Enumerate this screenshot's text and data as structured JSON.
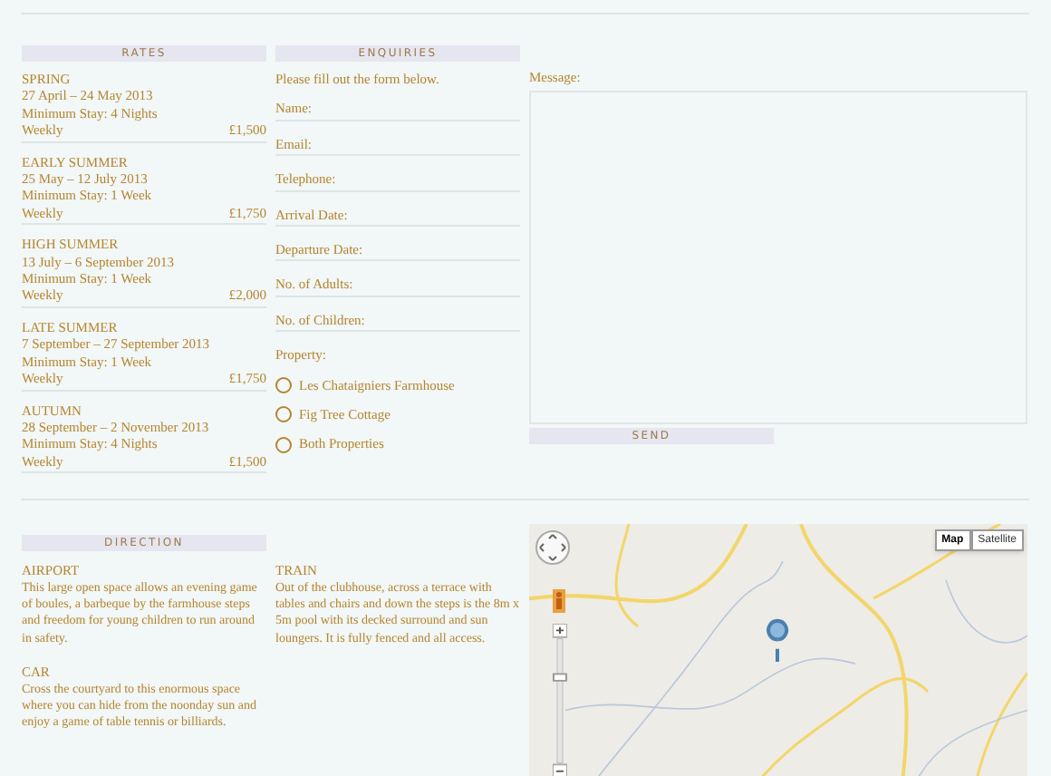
{
  "rates": {
    "title": "RATES",
    "periods": [
      {
        "name": "SPRING",
        "dates": "27 April – 24 May 2013",
        "min_stay": "Minimum Stay: 4 Nights",
        "label": "Weekly",
        "price": "£1,500"
      },
      {
        "name": "EARLY SUMMER",
        "dates": "25 May – 12 July 2013",
        "min_stay": "Minimum Stay: 1 Week",
        "label": "Weekly",
        "price": "£1,750"
      },
      {
        "name": "HIGH SUMMER",
        "dates": "13 July – 6 September 2013",
        "min_stay": "Minimum Stay: 1 Week",
        "label": "Weekly",
        "price": "£2,000"
      },
      {
        "name": "LATE SUMMER",
        "dates": "7 September – 27 September 2013",
        "min_stay": "Minimum Stay: 1 Week",
        "label": "Weekly",
        "price": "£1,750"
      },
      {
        "name": "AUTUMN",
        "dates": "28 September – 2 November 2013",
        "min_stay": "Minimum Stay: 4 Nights",
        "label": "Weekly",
        "price": "£1,500"
      }
    ]
  },
  "enquiries": {
    "title": "ENQUIRIES",
    "intro": "Please fill out the form below.",
    "fields": [
      {
        "label": "Name:"
      },
      {
        "label": "Email:"
      },
      {
        "label": "Telephone:"
      },
      {
        "label": "Arrival Date:"
      },
      {
        "label": "Departure Date:"
      },
      {
        "label": "No. of Adults:"
      },
      {
        "label": "No. of Children:"
      }
    ],
    "property_label": "Property:",
    "options": [
      {
        "label": "Les Chataigniers Farmhouse",
        "selected": false
      },
      {
        "label": "Fig Tree Cottage",
        "selected": false
      },
      {
        "label": "Both Properties",
        "selected": false
      }
    ]
  },
  "message": {
    "label": "Message:",
    "send": "SEND"
  },
  "direction": {
    "title": "DIRECTION",
    "columns": [
      [
        {
          "heading": "AIRPORT",
          "text": "This large open space allows an evening game of boules, a barbeque by the farmhouse steps and freedom for young children to run around in safety."
        },
        {
          "heading": "CAR",
          "text": "Cross the courtyard to this enormous space where you can hide from the noonday sun and enjoy a game of table tennis or billiards."
        }
      ],
      [
        {
          "heading": "TRAIN",
          "text": "Out of the clubhouse, across a terrace with tables and chairs and down the steps is the 8m x 5m pool with its decked surround and sun loungers. It is fully fenced and all access."
        }
      ]
    ]
  },
  "map": {
    "kind": "picture",
    "map_types": [
      {
        "label": "Map",
        "selected": true
      },
      {
        "label": "Satellite",
        "selected": false
      }
    ]
  }
}
